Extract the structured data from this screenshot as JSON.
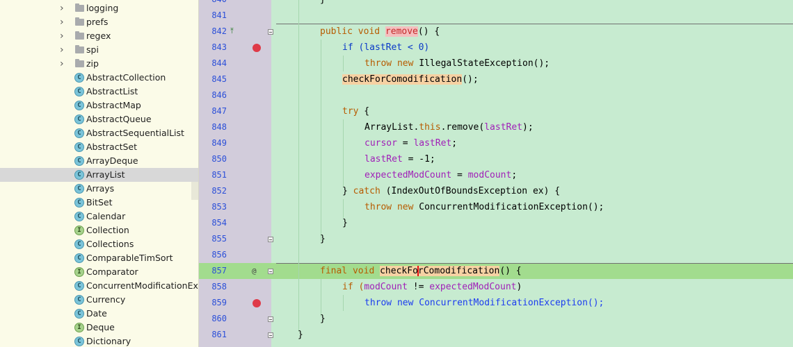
{
  "tree": {
    "folders": [
      "logging",
      "prefs",
      "regex",
      "spi",
      "zip"
    ],
    "items": [
      {
        "badge": "C",
        "kind": "class",
        "label": "AbstractCollection"
      },
      {
        "badge": "C",
        "kind": "class",
        "label": "AbstractList"
      },
      {
        "badge": "C",
        "kind": "class",
        "label": "AbstractMap"
      },
      {
        "badge": "C",
        "kind": "class",
        "label": "AbstractQueue"
      },
      {
        "badge": "C",
        "kind": "class",
        "label": "AbstractSequentialList"
      },
      {
        "badge": "C",
        "kind": "class",
        "label": "AbstractSet"
      },
      {
        "badge": "C",
        "kind": "class",
        "label": "ArrayDeque"
      },
      {
        "badge": "C",
        "kind": "class",
        "label": "ArrayList",
        "selected": true
      },
      {
        "badge": "C",
        "kind": "class",
        "label": "Arrays"
      },
      {
        "badge": "C",
        "kind": "class",
        "label": "BitSet"
      },
      {
        "badge": "C",
        "kind": "class",
        "label": "Calendar"
      },
      {
        "badge": "I",
        "kind": "interface",
        "label": "Collection"
      },
      {
        "badge": "C",
        "kind": "class",
        "label": "Collections"
      },
      {
        "badge": "C",
        "kind": "class",
        "label": "ComparableTimSort"
      },
      {
        "badge": "I",
        "kind": "interface",
        "label": "Comparator"
      },
      {
        "badge": "C",
        "kind": "class",
        "label": "ConcurrentModificationExce"
      },
      {
        "badge": "C",
        "kind": "class",
        "label": "Currency"
      },
      {
        "badge": "C",
        "kind": "class",
        "label": "Date"
      },
      {
        "badge": "I",
        "kind": "interface",
        "label": "Deque"
      },
      {
        "badge": "C",
        "kind": "class",
        "label": "Dictionary"
      }
    ]
  },
  "gutter": {
    "line_numbers": [
      "840",
      "841",
      "842",
      "843",
      "844",
      "845",
      "846",
      "847",
      "848",
      "849",
      "850",
      "851",
      "852",
      "853",
      "854",
      "855",
      "856",
      "857",
      "858",
      "859",
      "860",
      "861"
    ],
    "override_marker": "@"
  },
  "code": {
    "l840": "}",
    "l842_kw": "public void",
    "l842_name": "remove",
    "l842_rest": "() {",
    "l843_if": "if (",
    "l843_var": "lastRet",
    "l843_rest": " < 0)",
    "l844_kw": "throw new",
    "l844_rest": " IllegalStateException();",
    "l845_call": "checkForComodification",
    "l845_rest": "();",
    "l847_kw": "try",
    "l847_rest": " {",
    "l848_a": "ArrayList.",
    "l848_kw": "this",
    "l848_b": ".remove(",
    "l848_var": "lastRet",
    "l848_c": ");",
    "l849_var": "cursor",
    "l849_eq": " = ",
    "l849_var2": "lastRet",
    "l849_end": ";",
    "l850_var": "lastRet",
    "l850_rest": " = -1;",
    "l851_var": "expectedModCount",
    "l851_eq": " = ",
    "l851_var2": "modCount",
    "l851_end": ";",
    "l852_a": "} ",
    "l852_kw": "catch",
    "l852_rest": " (IndexOutOfBoundsException ex) {",
    "l853_kw": "throw new",
    "l853_rest": " ConcurrentModificationException();",
    "l854": "}",
    "l855": "}",
    "l857_kw": "final void",
    "l857_name_a": "checkFo",
    "l857_name_b": "rComodification",
    "l857_rest": "() {",
    "l858_if": "if (",
    "l858_var": "modCount",
    "l858_op": " != ",
    "l858_var2": "expectedModCount",
    "l858_end": ")",
    "l859_kw": "throw new",
    "l859_rest": " ConcurrentModificationException();",
    "l860": "}",
    "l861": "}"
  }
}
